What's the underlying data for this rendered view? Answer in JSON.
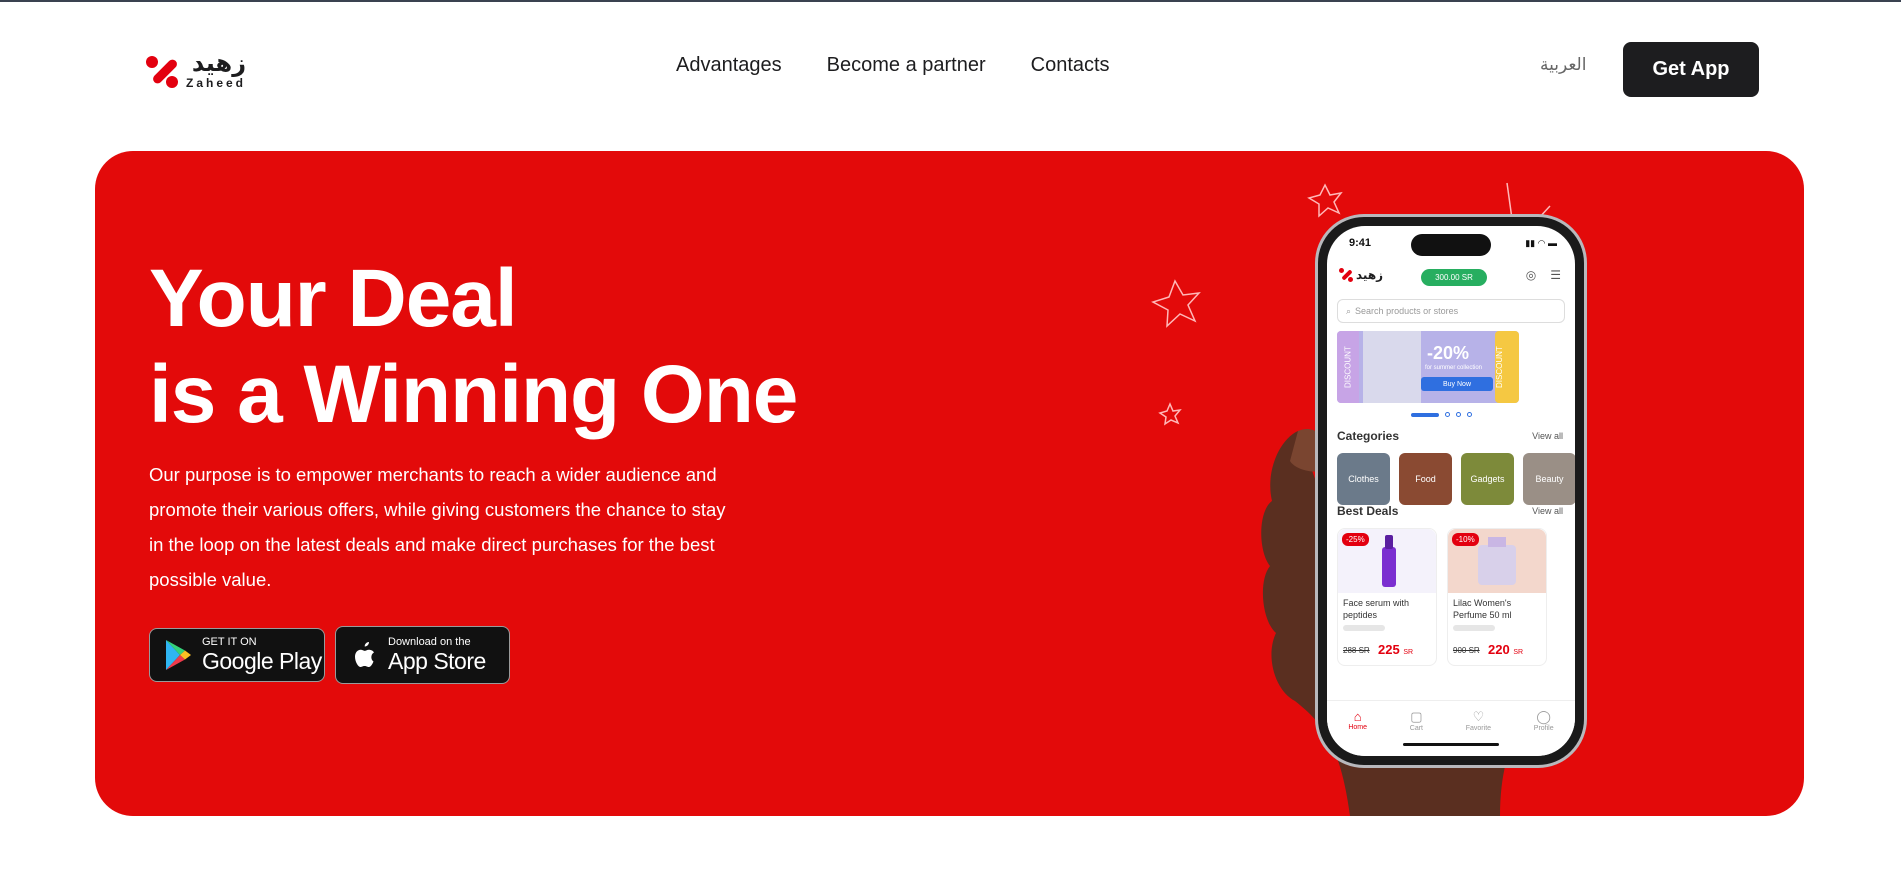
{
  "header": {
    "logo_arabic": "زهيد",
    "logo_latin": "Zaheed",
    "nav": [
      "Advantages",
      "Become a partner",
      "Contacts"
    ],
    "language_link": "العربية",
    "cta_label": "Get App"
  },
  "hero": {
    "title_line1": "Your Deal",
    "title_line2": "is a Winning One",
    "description": "Our purpose is to empower merchants to reach a wider audience and promote their various offers, while giving customers the chance to stay in the loop on the latest deals and make direct purchases for the best possible value.",
    "google_play": {
      "small": "GET IT ON",
      "big": "Google Play"
    },
    "app_store": {
      "small": "Download on the",
      "big": "App Store"
    },
    "accent_color": "#e30a0a"
  },
  "phone": {
    "time": "9:41",
    "logo_arabic": "زهيد",
    "balance": "300.00 SR",
    "search_placeholder": "Search products or stores",
    "banner_tab": "DISCOUNT",
    "banner_discount": "-20%",
    "banner_sub": "for summer collection",
    "banner_button": "Buy Now",
    "categories_title": "Categories",
    "view_all": "View all",
    "categories": [
      "Clothes",
      "Food",
      "Gadgets",
      "Beauty"
    ],
    "best_deals_title": "Best Deals",
    "deals": [
      {
        "tag": "-25%",
        "name": "Face serum with peptides",
        "old_price": "288 SR",
        "new_price": "225",
        "currency": "SR"
      },
      {
        "tag": "-10%",
        "name": "Lilac Women's Perfume 50 ml",
        "old_price": "900 SR",
        "new_price": "220",
        "currency": "SR"
      }
    ],
    "tabs": [
      "Home",
      "Cart",
      "Favorite",
      "Profile"
    ]
  }
}
